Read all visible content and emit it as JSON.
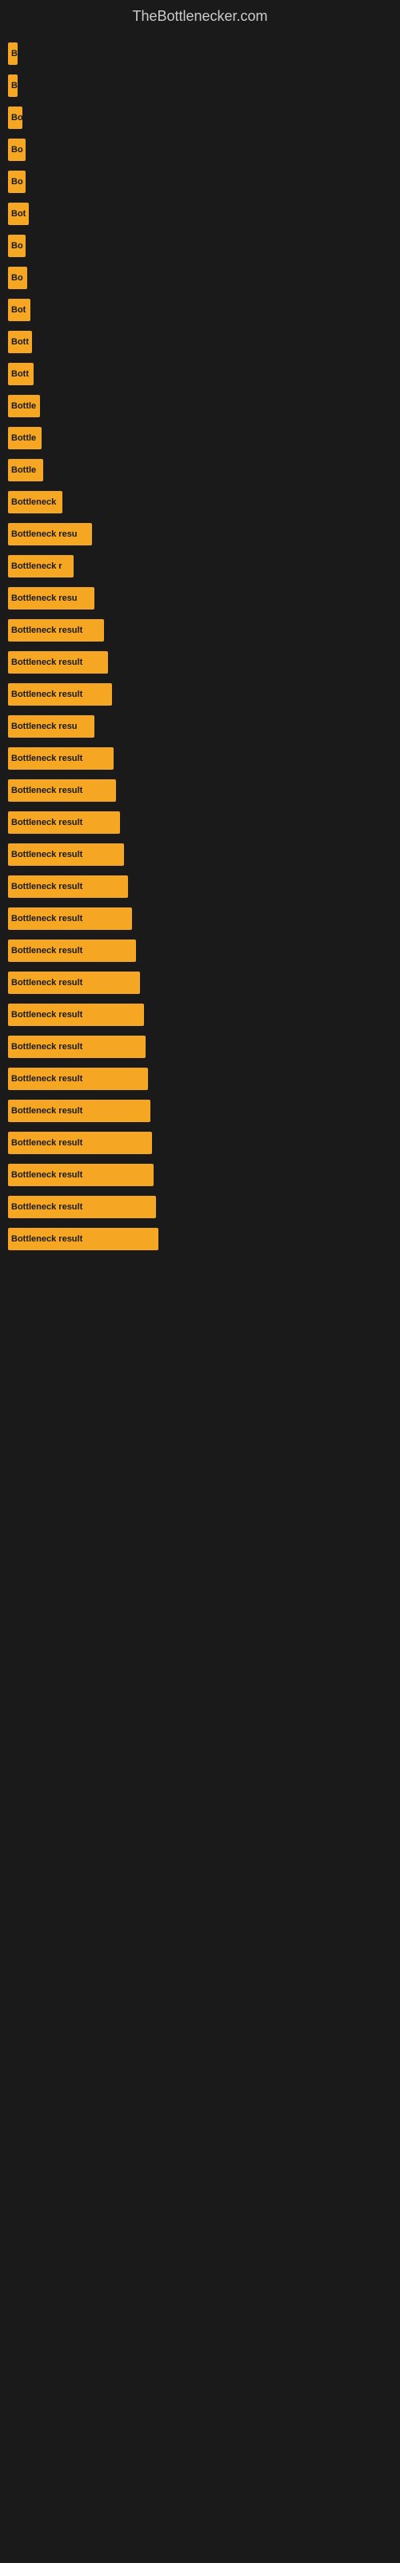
{
  "site": {
    "title": "TheBottlenecker.com"
  },
  "bars": [
    {
      "label": "B",
      "width": 12
    },
    {
      "label": "B",
      "width": 12
    },
    {
      "label": "Bo",
      "width": 18
    },
    {
      "label": "Bo",
      "width": 22
    },
    {
      "label": "Bo",
      "width": 22
    },
    {
      "label": "Bot",
      "width": 26
    },
    {
      "label": "Bo",
      "width": 22
    },
    {
      "label": "Bo",
      "width": 24
    },
    {
      "label": "Bot",
      "width": 28
    },
    {
      "label": "Bott",
      "width": 30
    },
    {
      "label": "Bott",
      "width": 32
    },
    {
      "label": "Bottle",
      "width": 40
    },
    {
      "label": "Bottle",
      "width": 42
    },
    {
      "label": "Bottle",
      "width": 44
    },
    {
      "label": "Bottleneck",
      "width": 68
    },
    {
      "label": "Bottleneck resu",
      "width": 105
    },
    {
      "label": "Bottleneck r",
      "width": 82
    },
    {
      "label": "Bottleneck resu",
      "width": 108
    },
    {
      "label": "Bottleneck result",
      "width": 120
    },
    {
      "label": "Bottleneck result",
      "width": 125
    },
    {
      "label": "Bottleneck result",
      "width": 130
    },
    {
      "label": "Bottleneck resu",
      "width": 108
    },
    {
      "label": "Bottleneck result",
      "width": 132
    },
    {
      "label": "Bottleneck result",
      "width": 135
    },
    {
      "label": "Bottleneck result",
      "width": 140
    },
    {
      "label": "Bottleneck result",
      "width": 145
    },
    {
      "label": "Bottleneck result",
      "width": 150
    },
    {
      "label": "Bottleneck result",
      "width": 155
    },
    {
      "label": "Bottleneck result",
      "width": 160
    },
    {
      "label": "Bottleneck result",
      "width": 165
    },
    {
      "label": "Bottleneck result",
      "width": 170
    },
    {
      "label": "Bottleneck result",
      "width": 172
    },
    {
      "label": "Bottleneck result",
      "width": 175
    },
    {
      "label": "Bottleneck result",
      "width": 178
    },
    {
      "label": "Bottleneck result",
      "width": 180
    },
    {
      "label": "Bottleneck result",
      "width": 182
    },
    {
      "label": "Bottleneck result",
      "width": 185
    },
    {
      "label": "Bottleneck result",
      "width": 188
    }
  ]
}
